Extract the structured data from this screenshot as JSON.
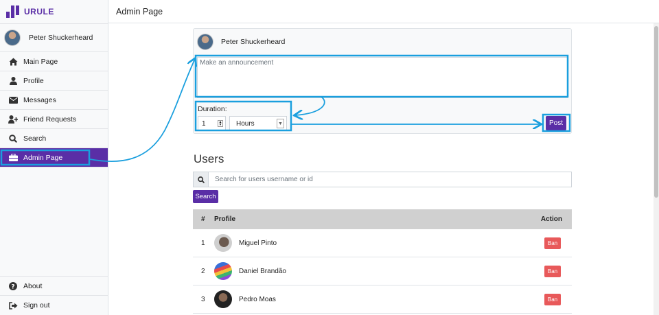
{
  "app": {
    "logo_text": "URULE",
    "brand_color": "#5a2ea6"
  },
  "header": {
    "title": "Admin Page"
  },
  "sidebar": {
    "user_name": "Peter Shuckerheard",
    "items": [
      {
        "label": "Main Page",
        "icon": "home-icon"
      },
      {
        "label": "Profile",
        "icon": "user-icon"
      },
      {
        "label": "Messages",
        "icon": "envelope-icon"
      },
      {
        "label": "Friend Requests",
        "icon": "user-plus-icon"
      },
      {
        "label": "Search",
        "icon": "search-icon"
      },
      {
        "label": "Admin Page",
        "icon": "toolbox-icon",
        "active": true
      }
    ],
    "bottom_items": [
      {
        "label": "About",
        "icon": "question-circle-icon"
      },
      {
        "label": "Sign out",
        "icon": "sign-out-icon"
      }
    ]
  },
  "announcement": {
    "author": "Peter Shuckerheard",
    "placeholder": "Make an announcement",
    "duration_label": "Duration:",
    "duration_value": "1",
    "unit_selected": "Hours",
    "post_label": "Post"
  },
  "users": {
    "title": "Users",
    "search_placeholder": "Search for users username or id",
    "search_button": "Search",
    "columns": [
      "#",
      "Profile",
      "Action"
    ],
    "rows": [
      {
        "num": "1",
        "name": "Miguel Pinto",
        "action": "Ban"
      },
      {
        "num": "2",
        "name": "Daniel Brandão",
        "action": "Ban"
      },
      {
        "num": "3",
        "name": "Pedro Moas",
        "action": "Ban"
      }
    ]
  },
  "annotation_color": "#1a9fde",
  "ban_color": "#e8595a"
}
